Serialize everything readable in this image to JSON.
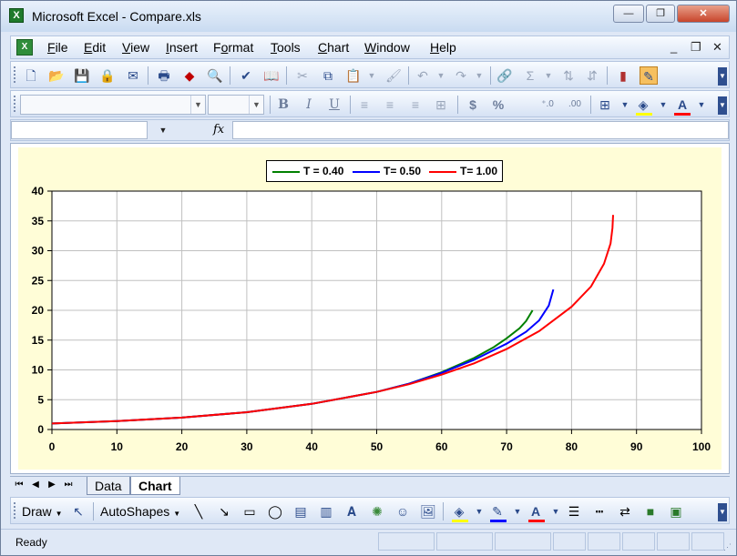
{
  "window": {
    "title": "Microsoft Excel - Compare.xls",
    "app_icon_glyph": "X",
    "doc_icon_glyph": "X",
    "minimize_glyph": "—",
    "restore_glyph": "❐",
    "close_glyph": "✕"
  },
  "menubar": {
    "items": [
      {
        "label": "File",
        "hotkey": "F",
        "rest": "ile"
      },
      {
        "label": "Edit",
        "hotkey": "E",
        "rest": "dit"
      },
      {
        "label": "View",
        "hotkey": "V",
        "rest": "iew"
      },
      {
        "label": "Insert",
        "hotkey": "I",
        "rest": "nsert"
      },
      {
        "label": "Format",
        "hotkey": "o",
        "pre": "F",
        "rest": "rmat"
      },
      {
        "label": "Tools",
        "hotkey": "T",
        "rest": "ools"
      },
      {
        "label": "Chart",
        "hotkey": "C",
        "rest": "hart"
      },
      {
        "label": "Window",
        "hotkey": "W",
        "rest": "indow"
      },
      {
        "label": "Help",
        "hotkey": "H",
        "rest": "elp"
      }
    ],
    "mdi_minimize": "_",
    "mdi_restore": "❐",
    "mdi_close": "✕"
  },
  "standard_toolbar": {
    "icons": [
      "new-icon",
      "open-icon",
      "save-icon",
      "permission-icon",
      "email-icon",
      "print-icon",
      "research-icon",
      "print-preview-icon",
      "spelling-icon",
      "research-book-icon",
      "cut-icon",
      "copy-icon",
      "paste-icon",
      "format-painter-icon",
      "undo-icon",
      "redo-icon",
      "hyperlink-icon",
      "autosum-icon",
      "sort-asc-icon",
      "sort-desc-icon",
      "chart-wizard-icon",
      "drawing-icon"
    ]
  },
  "formatting_toolbar": {
    "font_name": "",
    "font_size": "",
    "bold": "B",
    "italic": "I",
    "underline": "U",
    "currency": "$",
    "percent": "%",
    "increase_decimal": "⁺.0",
    "decrease_decimal": ".00",
    "font_color_label": "A",
    "fill_color": "#ffff00",
    "font_color": "#ff0000"
  },
  "formula_bar": {
    "name_box": "",
    "fx_label": "fx",
    "formula": ""
  },
  "sheet_tabs": {
    "tabs": [
      "Data",
      "Chart"
    ],
    "active": "Chart"
  },
  "drawing_toolbar": {
    "draw_label": "Draw",
    "autoshapes_label": "AutoShapes",
    "line_color": "#0000ff",
    "fill_color": "#ffff00",
    "font_color": "#ff0000"
  },
  "status": {
    "text": "Ready"
  },
  "chart_data": {
    "type": "line",
    "title": "",
    "xlabel": "",
    "ylabel": "",
    "xlim": [
      0,
      100
    ],
    "ylim": [
      0,
      40
    ],
    "x_ticks": [
      0,
      10,
      20,
      30,
      40,
      50,
      60,
      70,
      80,
      90,
      100
    ],
    "y_ticks": [
      0,
      5,
      10,
      15,
      20,
      25,
      30,
      35,
      40
    ],
    "grid": true,
    "legend": "top-center",
    "series": [
      {
        "name": "T = 0.40",
        "color": "#008000",
        "points": [
          [
            0,
            1.0
          ],
          [
            10,
            1.4
          ],
          [
            20,
            2.0
          ],
          [
            30,
            2.9
          ],
          [
            40,
            4.3
          ],
          [
            50,
            6.3
          ],
          [
            55,
            7.7
          ],
          [
            60,
            9.6
          ],
          [
            65,
            12.0
          ],
          [
            68,
            13.8
          ],
          [
            70,
            15.3
          ],
          [
            72,
            17.0
          ],
          [
            73,
            18.2
          ],
          [
            74,
            20.0
          ]
        ]
      },
      {
        "name": "T= 0.50",
        "color": "#0000ff",
        "points": [
          [
            0,
            1.0
          ],
          [
            10,
            1.4
          ],
          [
            20,
            2.0
          ],
          [
            30,
            2.9
          ],
          [
            40,
            4.3
          ],
          [
            50,
            6.3
          ],
          [
            55,
            7.7
          ],
          [
            60,
            9.5
          ],
          [
            65,
            11.7
          ],
          [
            70,
            14.4
          ],
          [
            73,
            16.4
          ],
          [
            75,
            18.3
          ],
          [
            76.5,
            20.8
          ],
          [
            77.2,
            23.5
          ]
        ]
      },
      {
        "name": "T= 1.00",
        "color": "#ff0000",
        "points": [
          [
            0,
            1.0
          ],
          [
            10,
            1.4
          ],
          [
            20,
            2.0
          ],
          [
            30,
            2.9
          ],
          [
            40,
            4.3
          ],
          [
            50,
            6.3
          ],
          [
            55,
            7.6
          ],
          [
            60,
            9.2
          ],
          [
            65,
            11.1
          ],
          [
            70,
            13.5
          ],
          [
            75,
            16.5
          ],
          [
            80,
            20.6
          ],
          [
            83,
            24.0
          ],
          [
            85,
            27.8
          ],
          [
            86,
            31.2
          ],
          [
            86.3,
            33.8
          ],
          [
            86.4,
            36.0
          ]
        ]
      }
    ]
  }
}
